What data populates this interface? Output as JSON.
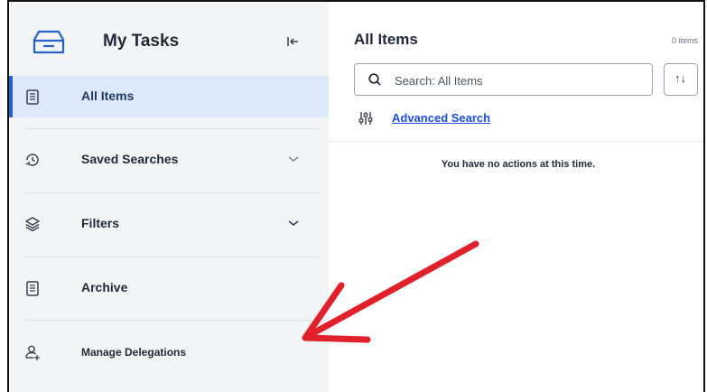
{
  "sidebar": {
    "title": "My Tasks",
    "items": [
      {
        "label": "All Items",
        "icon": "clipboard-icon",
        "active": true
      },
      {
        "label": "Saved Searches",
        "icon": "history-icon",
        "expandable": true
      },
      {
        "label": "Filters",
        "icon": "layers-icon",
        "expandable": true
      },
      {
        "label": "Archive",
        "icon": "clipboard-icon"
      },
      {
        "label": "Manage Delegations",
        "icon": "add-user-icon"
      }
    ]
  },
  "main": {
    "title": "All Items",
    "item_count": "0 items",
    "search_placeholder": "Search: All Items",
    "sort_glyph": "↑↓",
    "advanced_search_label": "Advanced Search",
    "empty_message": "You have no actions at this time."
  },
  "annotation": {
    "arrow_color": "#e0202a"
  },
  "colors": {
    "accent": "#2563c9",
    "active_bg": "#dde9fb",
    "sidebar_bg": "#f3f4f6",
    "link": "#1d4ed8"
  }
}
